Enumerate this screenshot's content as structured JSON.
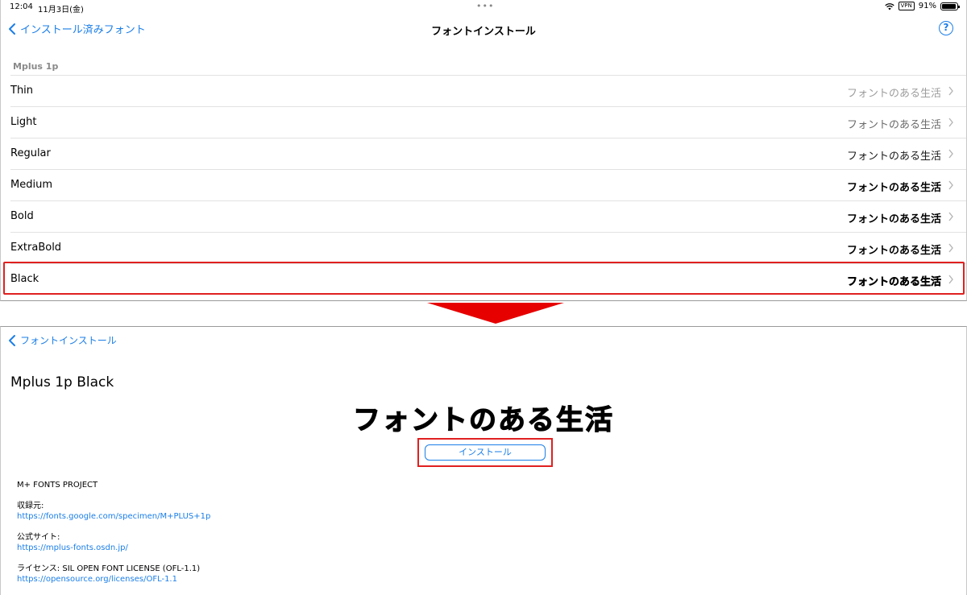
{
  "status": {
    "time": "12:04",
    "date": "11月3日(金)",
    "dots": "•••",
    "vpn": "VPN",
    "battery": "91%"
  },
  "nav": {
    "back_label": "インストール済みフォント",
    "title": "フォントインストール",
    "help": "?"
  },
  "section": "Mplus 1p",
  "weights": [
    {
      "label": "Thin",
      "sample": "フォントのある生活"
    },
    {
      "label": "Light",
      "sample": "フォントのある生活"
    },
    {
      "label": "Regular",
      "sample": "フォントのある生活"
    },
    {
      "label": "Medium",
      "sample": "フォントのある生活"
    },
    {
      "label": "Bold",
      "sample": "フォントのある生活"
    },
    {
      "label": "ExtraBold",
      "sample": "フォントのある生活"
    },
    {
      "label": "Black",
      "sample": "フォントのある生活"
    }
  ],
  "detail": {
    "back_label": "フォントインストール",
    "font_name": "Mplus 1p Black",
    "sample": "フォントのある生活",
    "install_label": "インストール",
    "project": "M+ FONTS PROJECT",
    "source_label": "収録元:",
    "source_url": "https://fonts.google.com/specimen/M+PLUS+1p",
    "site_label": "公式サイト:",
    "site_url": "https://mplus-fonts.osdn.jp/",
    "license_label": "ライセンス: SIL OPEN FONT LICENSE (OFL-1.1)",
    "license_url": "https://opensource.org/licenses/OFL-1.1"
  },
  "colors": {
    "accent": "#1a7ee8",
    "highlight": "#e02020"
  }
}
